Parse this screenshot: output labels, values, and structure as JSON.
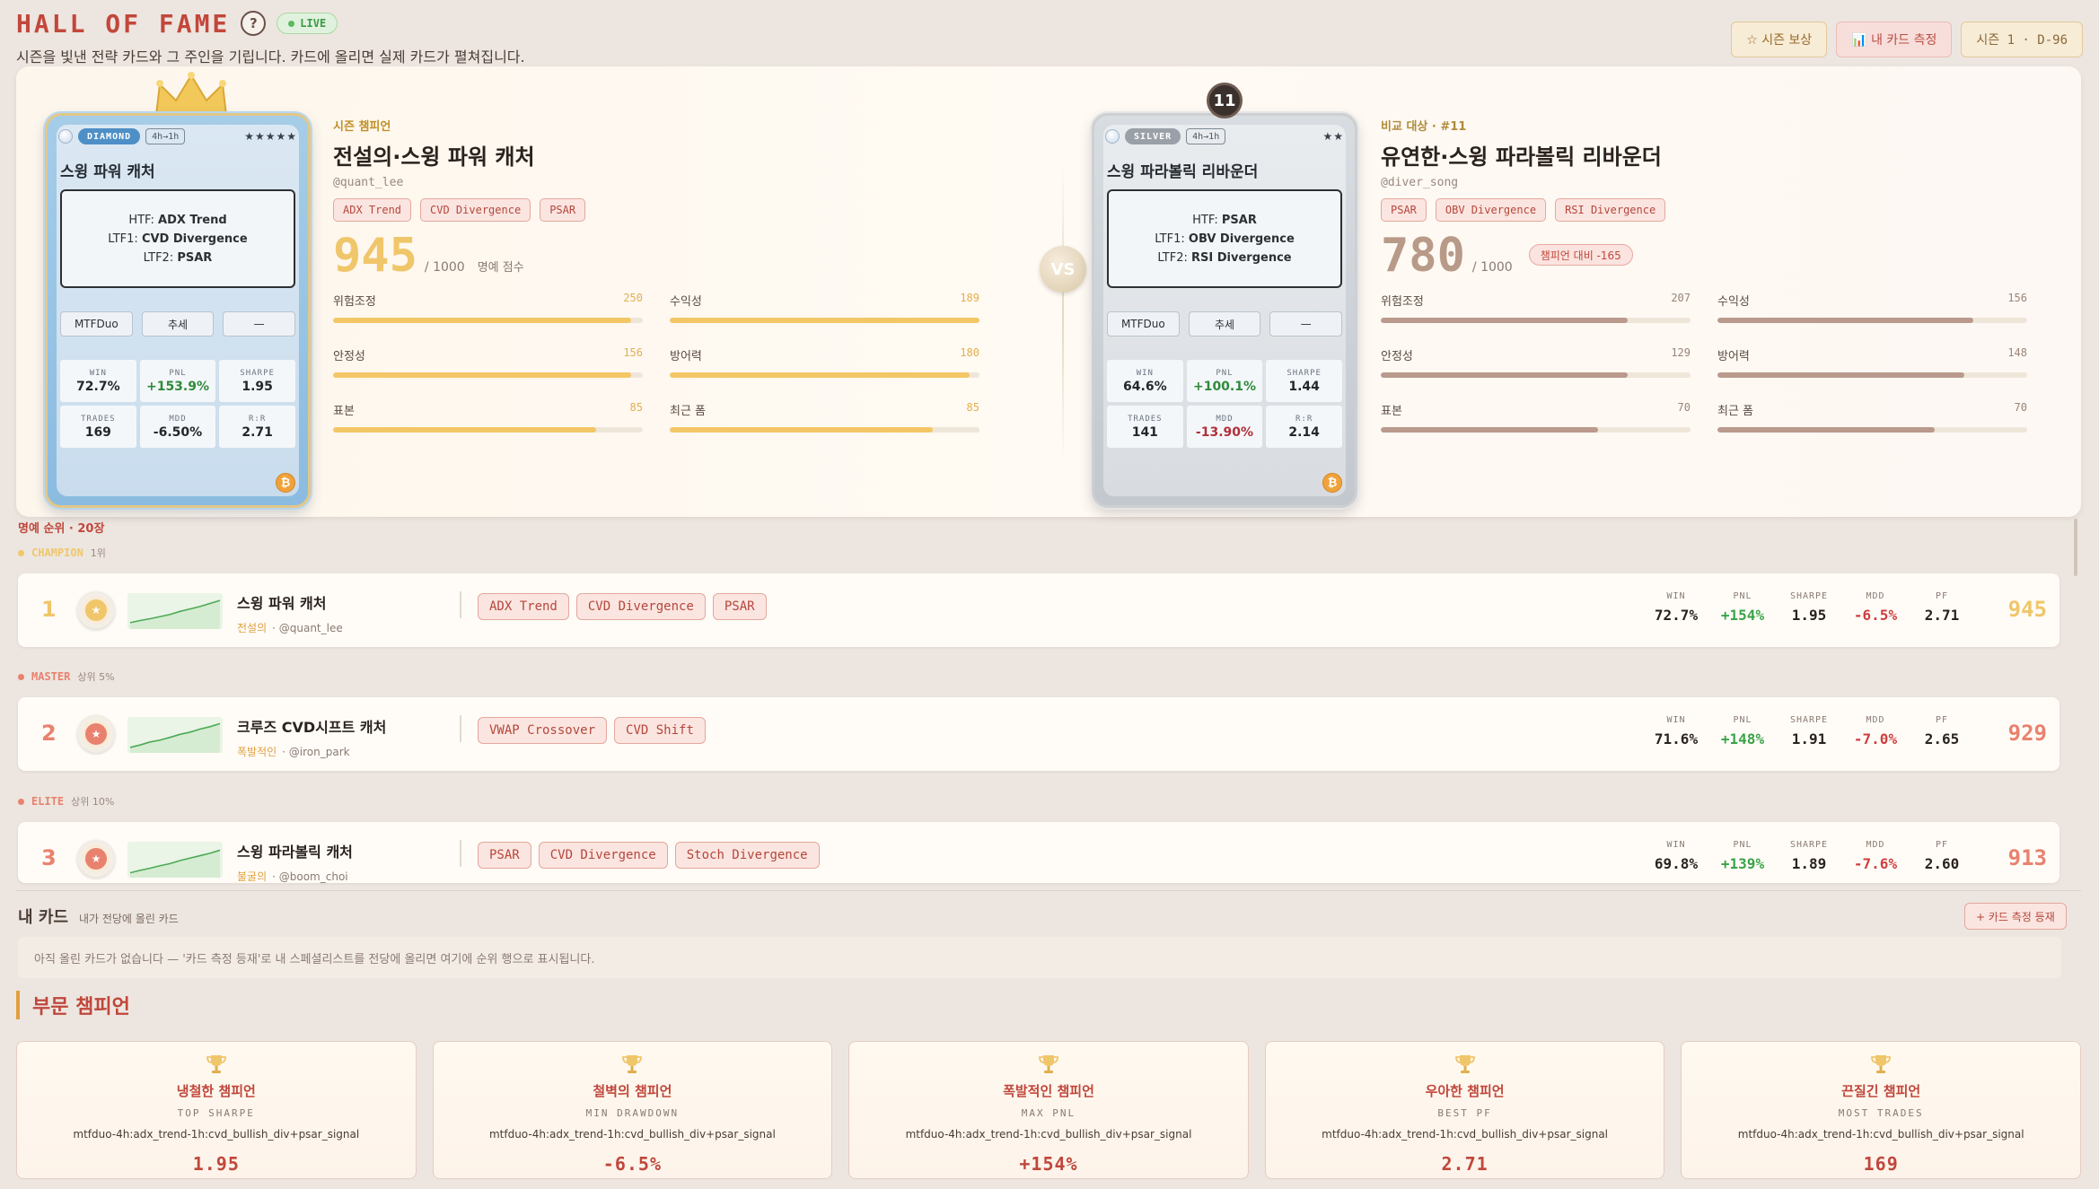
{
  "header": {
    "title": "HALL OF FAME",
    "help_label": "?",
    "live_label": "LIVE",
    "subtitle": "시즌을 빛낸 전략 카드와 그 주인을 기립니다. 카드에 올리면 실제 카드가 펼쳐집니다.",
    "buttons": {
      "rewards": "☆ 시즌 보상",
      "measure": "📊 내 카드 측정",
      "season": "시즌 1 · D-96"
    }
  },
  "champion_card": {
    "tier": "DIAMOND",
    "timeframe": "4h→1h",
    "stars": "★★★★★",
    "name": "스윙 파워 캐처",
    "strategy": [
      {
        "k": "HTF:",
        "v": "ADX Trend"
      },
      {
        "k": "LTF1:",
        "v": "CVD Divergence"
      },
      {
        "k": "LTF2:",
        "v": "PSAR"
      }
    ],
    "tags": [
      "MTFDuo",
      "추세",
      "—"
    ],
    "stats": [
      {
        "k": "WIN",
        "v": "72.7%",
        "tone": ""
      },
      {
        "k": "PNL",
        "v": "+153.9%",
        "tone": "pos"
      },
      {
        "k": "SHARPE",
        "v": "1.95",
        "tone": ""
      },
      {
        "k": "TRADES",
        "v": "169",
        "tone": ""
      },
      {
        "k": "MDD",
        "v": "-6.50%",
        "tone": ""
      },
      {
        "k": "R:R",
        "v": "2.71",
        "tone": ""
      }
    ],
    "coin": "₿"
  },
  "champion_info": {
    "kicker": "시즌 챔피언",
    "title": "전설의·스윙 파워 캐처",
    "handle": "@quant_lee",
    "tags": [
      "ADX Trend",
      "CVD Divergence",
      "PSAR"
    ],
    "score": "945",
    "score_max": "/ 1000",
    "score_label": "명예 점수",
    "bars": [
      {
        "label": "위험조정",
        "value": 250,
        "max": 260
      },
      {
        "label": "수익성",
        "value": 189,
        "max": 189
      },
      {
        "label": "안정성",
        "value": 156,
        "max": 162
      },
      {
        "label": "방어력",
        "value": 180,
        "max": 186
      },
      {
        "label": "표본",
        "value": 85,
        "max": 100
      },
      {
        "label": "최근 폼",
        "value": 85,
        "max": 100
      }
    ]
  },
  "compare_card": {
    "rank": "11",
    "tier": "SILVER",
    "timeframe": "4h→1h",
    "stars": "★★",
    "name": "스윙 파라볼릭 리바운더",
    "strategy": [
      {
        "k": "HTF:",
        "v": "PSAR"
      },
      {
        "k": "LTF1:",
        "v": "OBV Divergence"
      },
      {
        "k": "LTF2:",
        "v": "RSI Divergence"
      }
    ],
    "tags": [
      "MTFDuo",
      "추세",
      "—"
    ],
    "stats": [
      {
        "k": "WIN",
        "v": "64.6%",
        "tone": ""
      },
      {
        "k": "PNL",
        "v": "+100.1%",
        "tone": "pos"
      },
      {
        "k": "SHARPE",
        "v": "1.44",
        "tone": ""
      },
      {
        "k": "TRADES",
        "v": "141",
        "tone": ""
      },
      {
        "k": "MDD",
        "v": "-13.90%",
        "tone": "neg"
      },
      {
        "k": "R:R",
        "v": "2.14",
        "tone": ""
      }
    ],
    "coin": "₿"
  },
  "compare_info": {
    "kicker": "비교 대상 · #11",
    "title": "유연한·스윙 파라볼릭 리바운더",
    "handle": "@diver_song",
    "tags": [
      "PSAR",
      "OBV Divergence",
      "RSI Divergence"
    ],
    "score": "780",
    "score_max": "/ 1000",
    "diff_label": "챔피언 대비 -165",
    "bars": [
      {
        "label": "위험조정",
        "value": 207,
        "max": 260
      },
      {
        "label": "수익성",
        "value": 156,
        "max": 189
      },
      {
        "label": "안정성",
        "value": 129,
        "max": 162
      },
      {
        "label": "방어력",
        "value": 148,
        "max": 186
      },
      {
        "label": "표본",
        "value": 70,
        "max": 100
      },
      {
        "label": "최근 폼",
        "value": 70,
        "max": 100
      }
    ]
  },
  "vs_label": "VS",
  "ranking": {
    "heading": "명예 순위 · 20장",
    "sections": [
      {
        "tier": "CHAMPION",
        "sub": "1위",
        "color": "#f0c66a"
      },
      {
        "tier": "MASTER",
        "sub": "상위 5%",
        "color": "#e8826f"
      },
      {
        "tier": "ELITE",
        "sub": "상위 10%",
        "color": "#e8826f"
      }
    ],
    "metric_labels": [
      "WIN",
      "PNL",
      "SHARPE",
      "MDD",
      "PF"
    ],
    "rows": [
      {
        "rank": "1",
        "rank_color": "#f0c66a",
        "medal_color": "#f0c66a",
        "medal_glyph": "★",
        "name": "스윙 파워 캐처",
        "title_tag": "전설의",
        "handle": "· @quant_lee",
        "tags": [
          "ADX Trend",
          "CVD Divergence",
          "PSAR"
        ],
        "metrics": [
          "72.7%",
          "+154%",
          "1.95",
          "-6.5%",
          "2.71"
        ],
        "score": "945",
        "score_color": "#f0c66a",
        "spark": [
          0.15,
          0.22,
          0.28,
          0.35,
          0.42,
          0.52,
          0.6,
          0.68,
          0.78,
          0.88
        ]
      },
      {
        "rank": "2",
        "rank_color": "#e8826f",
        "medal_color": "#e8826f",
        "medal_glyph": "★",
        "name": "크루즈 CVD시프트 캐처",
        "title_tag": "폭발적인",
        "handle": "· @iron_park",
        "tags": [
          "VWAP Crossover",
          "CVD Shift"
        ],
        "metrics": [
          "71.6%",
          "+148%",
          "1.91",
          "-7.0%",
          "2.65"
        ],
        "score": "929",
        "score_color": "#e8826f",
        "spark": [
          0.12,
          0.2,
          0.3,
          0.36,
          0.45,
          0.55,
          0.62,
          0.72,
          0.8,
          0.9
        ]
      },
      {
        "rank": "3",
        "rank_color": "#e8826f",
        "medal_color": "#e8826f",
        "medal_glyph": "★",
        "name": "스윙 파라볼릭 캐처",
        "title_tag": "불굴의",
        "handle": "· @boom_choi",
        "tags": [
          "PSAR",
          "CVD Divergence",
          "Stoch Divergence"
        ],
        "metrics": [
          "69.8%",
          "+139%",
          "1.89",
          "-7.6%",
          "2.60"
        ],
        "score": "913",
        "score_color": "#e8826f",
        "spark": [
          0.1,
          0.18,
          0.25,
          0.33,
          0.4,
          0.5,
          0.58,
          0.66,
          0.74,
          0.84
        ]
      }
    ]
  },
  "my_cards": {
    "title": "내 카드",
    "subtitle": "내가 전당에 올린 카드",
    "register_label": "+ 카드 측정 등재",
    "empty_text": "아직 올린 카드가 없습니다 — '카드 측정 등재'로 내 스페셜리스트를 전당에 올리면 여기에 순위 행으로 표시됩니다."
  },
  "categories": {
    "title": "부문 챔피언",
    "items": [
      {
        "name": "냉철한 챔피언",
        "kind": "TOP SHARPE",
        "strategy": "mtfduo-4h:adx_trend-1h:cvd_bullish_div+psar_signal",
        "value": "1.95"
      },
      {
        "name": "철벽의 챔피언",
        "kind": "MIN DRAWDOWN",
        "strategy": "mtfduo-4h:adx_trend-1h:cvd_bullish_div+psar_signal",
        "value": "-6.5%"
      },
      {
        "name": "폭발적인 챔피언",
        "kind": "MAX PNL",
        "strategy": "mtfduo-4h:adx_trend-1h:cvd_bullish_div+psar_signal",
        "value": "+154%"
      },
      {
        "name": "우아한 챔피언",
        "kind": "BEST PF",
        "strategy": "mtfduo-4h:adx_trend-1h:cvd_bullish_div+psar_signal",
        "value": "2.71"
      },
      {
        "name": "끈질긴 챔피언",
        "kind": "MOST TRADES",
        "strategy": "mtfduo-4h:adx_trend-1h:cvd_bullish_div+psar_signal",
        "value": "169"
      }
    ]
  }
}
